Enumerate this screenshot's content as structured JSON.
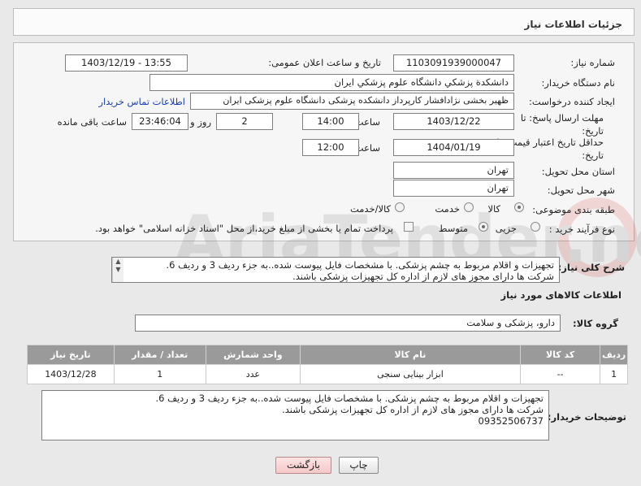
{
  "header": {
    "title": "جزئیات اطلاعات نیاز"
  },
  "form": {
    "need_number_label": "شماره نیاز:",
    "need_number": "1103091939000047",
    "announce_label": "تاریخ و ساعت اعلان عمومی:",
    "announce_value": "1403/12/19 - 13:55",
    "buyer_org_label": "نام دستگاه خریدار:",
    "buyer_org": "دانشکدة پزشکي دانشگاه علوم پزشکي ایران",
    "creator_label": "ایجاد کننده درخواست:",
    "creator": "ظهیر بخشی نژادافشار کارپرداز دانشکده پزشکی دانشگاه علوم پزشکی ایران",
    "contact_link": "اطلاعات تماس خریدار",
    "reply_deadline_label": "مهلت ارسال پاسخ: تا تاریخ:",
    "reply_date": "1403/12/22",
    "time_label": "ساعت",
    "reply_time": "14:00",
    "days_value": "2",
    "days_label": "روز و",
    "remaining_time": "23:46:04",
    "remaining_label": "ساعت باقی مانده",
    "min_price_label": "حداقل تاریخ اعتبار قیمت: تا تاریخ:",
    "min_price_date": "1404/01/19",
    "min_price_time": "12:00",
    "province_label": "استان محل تحویل:",
    "province": "تهران",
    "city_label": "شهر محل تحویل:",
    "city": "تهران",
    "category_label": "طبقه بندی موضوعی:",
    "category_options": [
      "کالا",
      "خدمت",
      "کالا/خدمت"
    ],
    "process_label": "نوع فرآیند خرید :",
    "process_options": [
      "جزیی",
      "متوسط"
    ],
    "payment_note": "پرداخت تمام یا بخشی از مبلغ خرید،از محل \"اسناد خزانه اسلامی\" خواهد بود."
  },
  "need_desc": {
    "label": "شرح کلی نیاز:",
    "line1": "تجهیزات و اقلام مربوط به چشم پزشکی. با مشخصات فایل پیوست شده..به جزء ردیف 3 و ردیف 6.",
    "line2": "شرکت ها دارای مجوز های لازم از اداره کل تجهیزات پزشکی باشند."
  },
  "goods": {
    "section_title": "اطلاعات کالاهای مورد نیاز",
    "group_label": "گروه کالا:",
    "group_value": "دارو، پزشکی و سلامت",
    "columns": [
      "ردیف",
      "کد کالا",
      "نام کالا",
      "واحد شمارش",
      "تعداد / مقدار",
      "تاریخ نیاز"
    ],
    "rows": [
      [
        "1",
        "--",
        "ابزار بینایی سنجی",
        "عدد",
        "1",
        "1403/12/28"
      ]
    ]
  },
  "buyer_notes": {
    "label": "توضیحات خریدار:",
    "line1": "تجهیزات و اقلام مربوط به چشم پزشکی. با مشخصات فایل پیوست شده..به جزء ردیف 3 و ردیف 6.",
    "line2": "شرکت ها دارای مجوز های لازم از اداره کل تجهیزات پزشکی باشند.",
    "line3": "09352506737"
  },
  "buttons": {
    "print": "چاپ",
    "back": "بازگشت"
  },
  "watermark": {
    "text": "AriaTender.neT"
  }
}
